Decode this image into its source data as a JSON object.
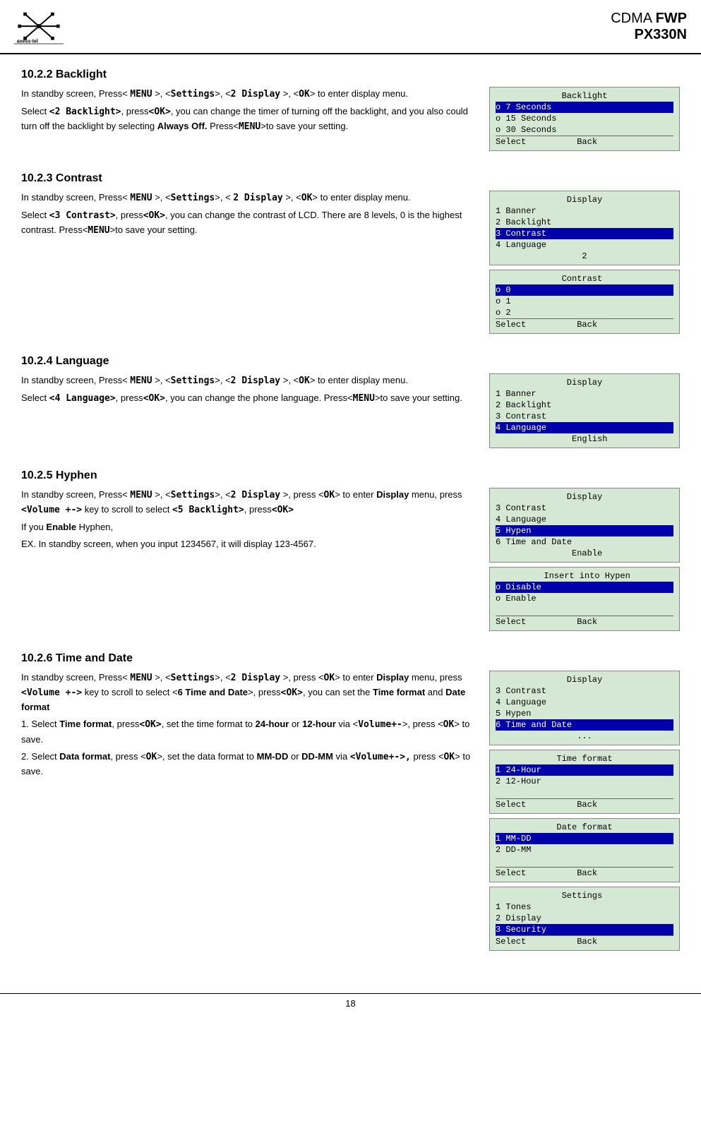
{
  "header": {
    "title_prefix": "CDMA ",
    "title_model": "FWP",
    "title_sub": "PX330N"
  },
  "page_number": "18",
  "sections": [
    {
      "id": "backlight",
      "title": "10.2.2 Backlight",
      "body": [
        "In standby screen, Press< MENU >, <Settings>, <2 Display >, <OK> to enter display menu.",
        "Select <2 Backlight>, press<OK>, you can change the timer of turning off the backlight, and you also could turn off the backlight by selecting Always Off. Press<MENU>to save your setting."
      ],
      "screens": [
        {
          "rows": [
            {
              "text": "   Backlight   ",
              "selected": false,
              "title": true
            },
            {
              "text": "o 7 Seconds    ",
              "selected": true
            },
            {
              "text": "o 15 Seconds   ",
              "selected": false
            },
            {
              "text": "o 30 Seconds   ",
              "selected": false
            },
            {
              "text": "Select          Back",
              "selected": false,
              "bar": true
            }
          ]
        }
      ]
    },
    {
      "id": "contrast",
      "title": "10.2.3 Contrast",
      "body": [
        "In standby screen, Press< MENU >, <Settings>, < 2 Display >, <OK> to enter display menu.",
        "Select <3 Contrast>, press<OK>, you can change the contrast of LCD. There are 8 levels, 0 is the highest contrast. Press<MENU>to save your setting."
      ],
      "screens": [
        {
          "rows": [
            {
              "text": "    Display    ",
              "selected": false,
              "title": true
            },
            {
              "text": "1 Banner       ",
              "selected": false
            },
            {
              "text": "2 Backlight    ",
              "selected": false
            },
            {
              "text": "3 Contrast     ",
              "selected": true
            },
            {
              "text": "4 Language     ",
              "selected": false
            },
            {
              "text": "       2       ",
              "selected": false,
              "center": true
            }
          ]
        },
        {
          "rows": [
            {
              "text": "   Contrast    ",
              "selected": false,
              "title": true
            },
            {
              "text": "o 0            ",
              "selected": true
            },
            {
              "text": "o 1            ",
              "selected": false
            },
            {
              "text": "o 2            ",
              "selected": false
            },
            {
              "text": "Select          Back",
              "selected": false,
              "bar": true
            }
          ]
        }
      ]
    },
    {
      "id": "language",
      "title": "10.2.4 Language",
      "body": [
        "In standby screen, Press< MENU >, <Settings>, <2 Display >, <OK> to enter display menu.",
        "Select <4 Language>, press<OK>, you can change the phone language. Press<MENU>to save your setting."
      ],
      "screens": [
        {
          "rows": [
            {
              "text": "    Display    ",
              "selected": false,
              "title": true
            },
            {
              "text": "1 Banner       ",
              "selected": false
            },
            {
              "text": "2 Backlight    ",
              "selected": false
            },
            {
              "text": "3 Contrast     ",
              "selected": false
            },
            {
              "text": "4 Language     ",
              "selected": true
            },
            {
              "text": "     English   ",
              "selected": false,
              "center": true
            }
          ]
        }
      ]
    },
    {
      "id": "hyphen",
      "title": "10.2.5 Hyphen",
      "body": [
        "In standby screen, Press< MENU >, <Settings>, <2 Display >, press <OK> to enter Display menu, press <Volume +-> key to scroll to select <5 Backlight>, press<OK>",
        "If you Enable Hyphen,",
        "EX. In standby screen, when you input 1234567, it will display 123-4567."
      ],
      "screens": [
        {
          "rows": [
            {
              "text": "    Display    ",
              "selected": false,
              "title": true
            },
            {
              "text": "3 Contrast     ",
              "selected": false
            },
            {
              "text": "4 Language     ",
              "selected": false
            },
            {
              "text": "5 Hypen        ",
              "selected": true
            },
            {
              "text": "6 Time and Date",
              "selected": false
            },
            {
              "text": "     Enable    ",
              "selected": false,
              "center": true
            }
          ]
        },
        {
          "rows": [
            {
              "text": " Insert into Hypen",
              "selected": false,
              "title": true
            },
            {
              "text": "o Disable      ",
              "selected": true
            },
            {
              "text": "o Enable       ",
              "selected": false
            },
            {
              "text": "               ",
              "selected": false
            },
            {
              "text": "Select          Back",
              "selected": false,
              "bar": true
            }
          ]
        }
      ]
    },
    {
      "id": "time_date",
      "title": "10.2.6 Time and Date",
      "body": [
        "In standby screen, Press< MENU >, <Settings>, <2 Display >, press <OK> to enter Display menu, press <Volume +-> key to scroll to select <6 Time and Date>, press<OK>, you can set the Time format and Date format",
        "1. Select Time format, press<OK>, set the time format to 24-hour or 12-hour via <Volume+->, press <OK> to save.",
        "2. Select Data format, press <OK>, set the data format to MM-DD or DD-MM via <Volume+->, press <OK> to save."
      ],
      "screens": [
        {
          "rows": [
            {
              "text": "    Display    ",
              "selected": false,
              "title": true
            },
            {
              "text": "3 Contrast     ",
              "selected": false
            },
            {
              "text": "4 Language     ",
              "selected": false
            },
            {
              "text": "5 Hypen        ",
              "selected": false
            },
            {
              "text": "6 Time and Date",
              "selected": true
            },
            {
              "text": "      ...      ",
              "selected": false,
              "center": true
            }
          ]
        },
        {
          "rows": [
            {
              "text": "  Time format  ",
              "selected": false,
              "title": true
            },
            {
              "text": "1 24-Hour      ",
              "selected": true
            },
            {
              "text": "2 12-Hour      ",
              "selected": false
            },
            {
              "text": "               ",
              "selected": false
            },
            {
              "text": "Select          Back",
              "selected": false,
              "bar": true
            }
          ]
        },
        {
          "rows": [
            {
              "text": "  Date format  ",
              "selected": false,
              "title": true
            },
            {
              "text": "1 MM-DD        ",
              "selected": true
            },
            {
              "text": "2 DD-MM        ",
              "selected": false
            },
            {
              "text": "               ",
              "selected": false
            },
            {
              "text": "Select          Back",
              "selected": false,
              "bar": true
            }
          ]
        },
        {
          "rows": [
            {
              "text": "   Settings    ",
              "selected": false,
              "title": true
            },
            {
              "text": "1 Tones        ",
              "selected": false
            },
            {
              "text": "2 Display      ",
              "selected": false
            },
            {
              "text": "3 Security     ",
              "selected": true
            },
            {
              "text": "Select          Back",
              "selected": false,
              "bar": true
            }
          ]
        }
      ]
    }
  ]
}
